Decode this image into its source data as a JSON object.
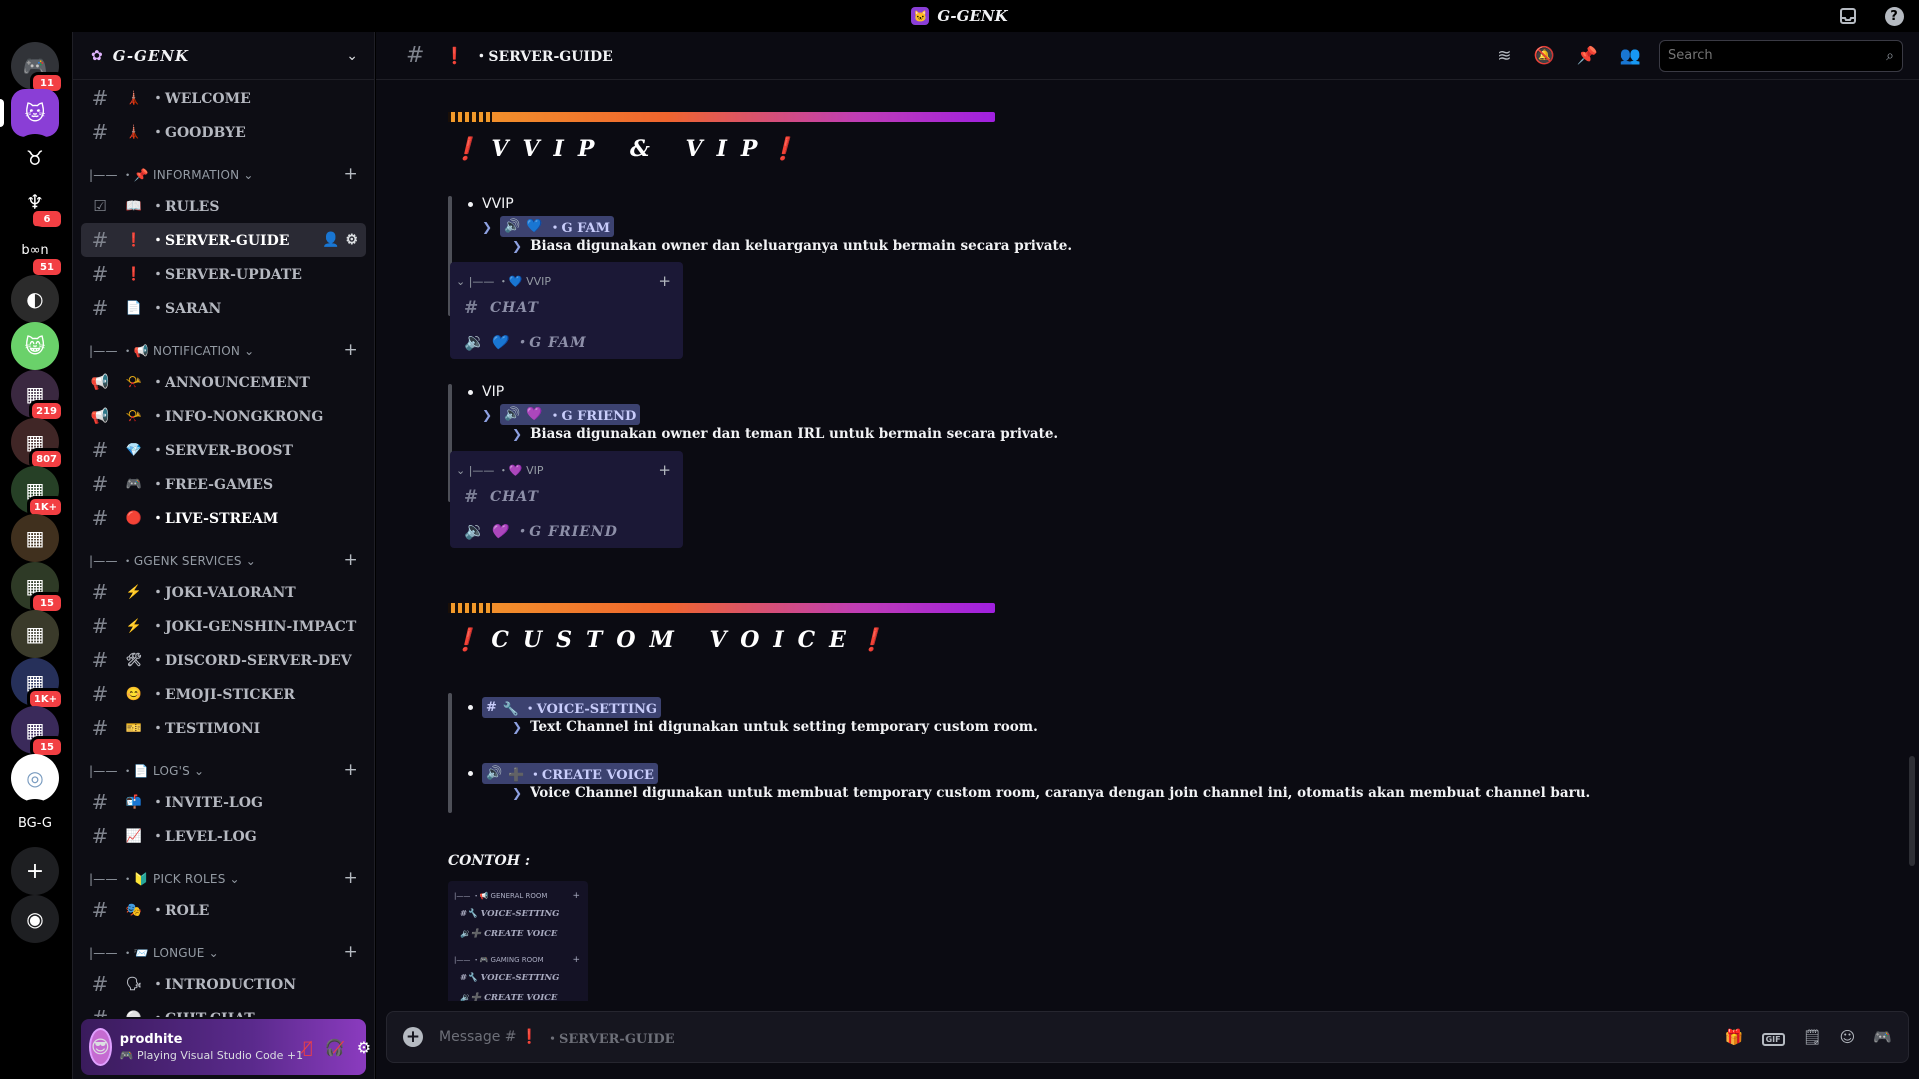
{
  "app": {
    "title": "G-GENK",
    "icon": "purple-cat-logo"
  },
  "titlebar": {
    "inbox_icon": "inbox-icon",
    "help": "?"
  },
  "servers": [
    {
      "name": "direct-messages",
      "glyph": "🎮",
      "badge": "11",
      "bg": "#313338"
    },
    {
      "name": "g-genk",
      "glyph": "🐱",
      "badge": "",
      "bg": "#8a3ed6"
    },
    {
      "name": "server-3",
      "glyph": "♉",
      "badge": "",
      "bg": "#000000"
    },
    {
      "name": "server-4",
      "glyph": "♆",
      "badge": "6",
      "bg": "#000000"
    },
    {
      "name": "server-5",
      "glyph": "b∞n",
      "badge": "51",
      "bg": "#000000"
    },
    {
      "name": "server-6",
      "glyph": "◐",
      "badge": "",
      "bg": "#2b2b2b"
    },
    {
      "name": "server-7",
      "glyph": "😸",
      "badge": "",
      "bg": "#6ad16a"
    },
    {
      "name": "folder-1",
      "glyph": "▦",
      "badge": "219",
      "bg": "#3a2840"
    },
    {
      "name": "folder-2",
      "glyph": "▦",
      "badge": "807",
      "bg": "#402626"
    },
    {
      "name": "folder-3",
      "glyph": "▦",
      "badge": "1K+",
      "bg": "#264026"
    },
    {
      "name": "folder-4",
      "glyph": "▦",
      "badge": "",
      "bg": "#40301e"
    },
    {
      "name": "folder-5",
      "glyph": "▦",
      "badge": "15",
      "bg": "#2e3a26"
    },
    {
      "name": "folder-6",
      "glyph": "▦",
      "badge": "",
      "bg": "#3a3a2a"
    },
    {
      "name": "folder-7",
      "glyph": "▦",
      "badge": "1K+",
      "bg": "#26305a"
    },
    {
      "name": "folder-8",
      "glyph": "▦",
      "badge": "15",
      "bg": "#3a2a5a"
    },
    {
      "name": "server-ids",
      "glyph": "◎",
      "badge": "",
      "bg": "#ffffff"
    },
    {
      "name": "server-bgg",
      "glyph": "BG-G",
      "badge": "",
      "bg": "#000000"
    }
  ],
  "server_actions": {
    "add": "+",
    "discover": "◉"
  },
  "guild": {
    "name": "G-GENK"
  },
  "sidebar": {
    "rows": [
      {
        "kind": "ch",
        "icon": "#",
        "emoji": "🗼",
        "label": "・WELCOME",
        "state": ""
      },
      {
        "kind": "ch",
        "icon": "#",
        "emoji": "🗼",
        "label": "・GOODBYE",
        "state": ""
      },
      {
        "kind": "cat",
        "label": "|—— ・📌 INFORMATION ⌄"
      },
      {
        "kind": "ch",
        "icon": "☑",
        "emoji": "📖",
        "label": "・RULES",
        "state": ""
      },
      {
        "kind": "ch",
        "icon": "#",
        "emoji": "❗",
        "label": "・SERVER-GUIDE",
        "state": "active"
      },
      {
        "kind": "ch",
        "icon": "#",
        "emoji": "❗",
        "label": "・SERVER-UPDATE",
        "state": ""
      },
      {
        "kind": "ch",
        "icon": "#",
        "emoji": "📄",
        "label": "・SARAN",
        "state": ""
      },
      {
        "kind": "cat",
        "label": "|—— ・📢 NOTIFICATION ⌄"
      },
      {
        "kind": "ch",
        "icon": "📢",
        "emoji": "📯",
        "label": "・ANNOUNCEMENT",
        "state": ""
      },
      {
        "kind": "ch",
        "icon": "📢",
        "emoji": "📯",
        "label": "・INFO-NONGKRONG",
        "state": ""
      },
      {
        "kind": "ch",
        "icon": "#",
        "emoji": "💎",
        "label": "・SERVER-BOOST",
        "state": ""
      },
      {
        "kind": "ch",
        "icon": "#",
        "emoji": "🎮",
        "label": "・FREE-GAMES",
        "state": ""
      },
      {
        "kind": "ch",
        "icon": "#",
        "emoji": "🔴",
        "label": "・LIVE-STREAM",
        "state": "unread"
      },
      {
        "kind": "cat",
        "label": "|—— ・GGENK SERVICES ⌄"
      },
      {
        "kind": "ch",
        "icon": "#",
        "emoji": "⚡",
        "label": "・JOKI-VALORANT",
        "state": ""
      },
      {
        "kind": "ch",
        "icon": "#",
        "emoji": "⚡",
        "label": "・JOKI-GENSHIN-IMPACT",
        "state": ""
      },
      {
        "kind": "ch",
        "icon": "#",
        "emoji": "🛠",
        "label": "・DISCORD-SERVER-DEV",
        "state": ""
      },
      {
        "kind": "ch",
        "icon": "#",
        "emoji": "😊",
        "label": "・EMOJI-STICKER",
        "state": ""
      },
      {
        "kind": "ch",
        "icon": "#",
        "emoji": "🎫",
        "label": "・TESTIMONI",
        "state": ""
      },
      {
        "kind": "cat",
        "label": "|—— ・📄 LOG'S ⌄"
      },
      {
        "kind": "ch",
        "icon": "#",
        "emoji": "📬",
        "label": "・INVITE-LOG",
        "state": ""
      },
      {
        "kind": "ch",
        "icon": "#",
        "emoji": "📈",
        "label": "・LEVEL-LOG",
        "state": ""
      },
      {
        "kind": "cat",
        "label": "|—— ・🔰 PICK ROLES ⌄"
      },
      {
        "kind": "ch",
        "icon": "#",
        "emoji": "🎭",
        "label": "・ROLE",
        "state": ""
      },
      {
        "kind": "cat",
        "label": "|—— ・📨 LONGUE ⌄"
      },
      {
        "kind": "ch",
        "icon": "#",
        "emoji": "🗣",
        "label": "・INTRODUCTION",
        "state": ""
      },
      {
        "kind": "ch",
        "icon": "#",
        "emoji": "⚪",
        "label": "・CHIT-CHAT",
        "state": ""
      }
    ]
  },
  "user": {
    "name": "prodhite",
    "status": "🎮 Playing Visual Studio Code +1"
  },
  "channel_header": {
    "hash": "#",
    "emoji": "❗",
    "name": "・SERVER-GUIDE",
    "search_placeholder": "Search"
  },
  "content": {
    "section1_title": "VVIP & VIP",
    "vvip": {
      "bullet": "VVIP",
      "mention": "・G FAM",
      "mention_emoji": "💙",
      "desc": "Biasa digunakan owner dan keluarganya untuk bermain secara private.",
      "card_header": "|—— ・💙 VVIP",
      "card_chat": "CHAT",
      "card_voice": "💙 ・G FAM"
    },
    "vip": {
      "bullet": "VIP",
      "mention": "・G FRIEND",
      "mention_emoji": "💜",
      "desc": "Biasa digunakan owner dan teman IRL untuk bermain secara private.",
      "card_header": "|—— ・💜 VIP",
      "card_chat": "CHAT",
      "card_voice": "💜 ・G FRIEND"
    },
    "section2_title": "CUSTOM VOICE",
    "voice_setting": {
      "mention": "🔧 ・VOICE-SETTING",
      "desc": "Text Channel ini digunakan untuk setting temporary custom room."
    },
    "create_voice": {
      "mention": "➕ ・CREATE VOICE",
      "desc": "Voice Channel digunakan untuk membuat temporary custom room, caranya dengan join channel ini, otomatis akan membuat channel baru."
    },
    "contoh": "CONTOH :",
    "example": {
      "cat1": "|—— ・📢 GENERAL ROOM",
      "cat2": "|—— ・🎮 GAMING ROOM",
      "voice_setting": "VOICE-SETTING",
      "create_voice": "CREATE VOICE"
    }
  },
  "composer": {
    "prefix": "Message #",
    "emoji": "❗",
    "name": "・SERVER-GUIDE",
    "gif": "GIF"
  },
  "colors": {
    "accent": "#8a3ed6",
    "mention_bg": "#3c4270",
    "embed_bg": "#1b1836",
    "danger": "#f23f43"
  }
}
